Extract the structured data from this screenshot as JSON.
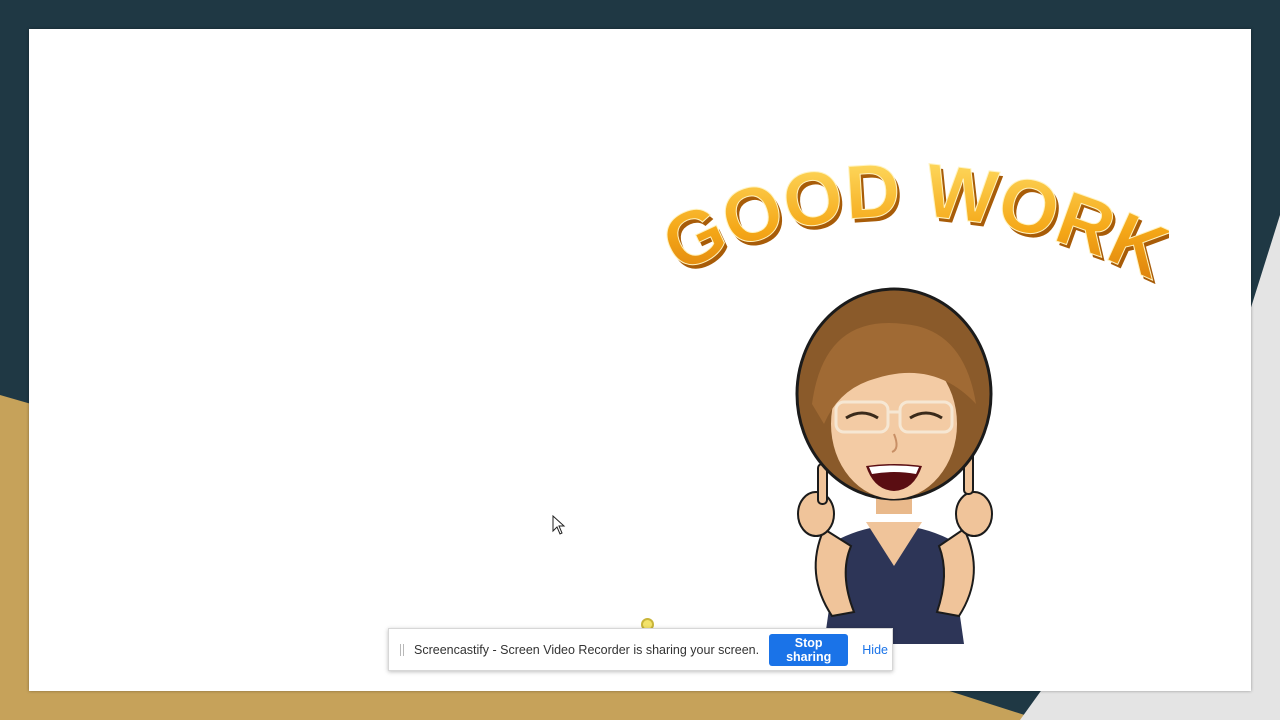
{
  "slide": {
    "sticker_text": "GOOD WORK"
  },
  "share_bar": {
    "message": "Screencastify - Screen Video Recorder is sharing your screen.",
    "stop_label": "Stop sharing",
    "hide_label": "Hide"
  },
  "colors": {
    "background_dark": "#1f3844",
    "background_gold": "#c6a25a",
    "background_light": "#e4e4e4",
    "accent_blue": "#1a73e8",
    "sticker_gold": "#f2a516"
  },
  "icons": [
    "drag-handle-icon",
    "mouse-cursor-icon",
    "click-indicator-icon"
  ]
}
